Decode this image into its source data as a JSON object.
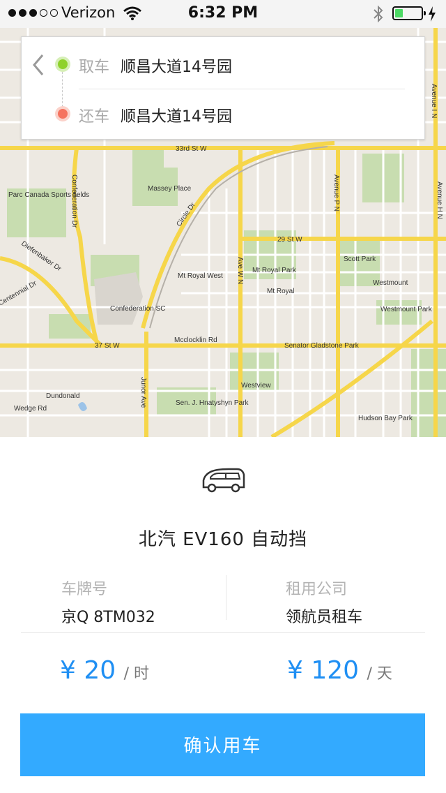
{
  "status_bar": {
    "carrier": "Verizon",
    "time": "6:32 PM",
    "signal_bars_filled": 3,
    "signal_bars_total": 5,
    "battery_level": 0.3
  },
  "route": {
    "pickup_label": "取车",
    "pickup_location": "顺昌大道14号园",
    "return_label": "还车",
    "return_location": "顺昌大道14号园"
  },
  "map": {
    "labels": [
      "33rd St W",
      "Parc Canada Sports fields",
      "Massey Place",
      "Confederation Dr",
      "Circle Dr",
      "29 St W",
      "Ave W N",
      "Avenue P N",
      "Avenue I N",
      "Avenue H N",
      "Scott Park",
      "Westmount",
      "Westmount Park",
      "Mt Royal Park",
      "Mt Royal",
      "Mt Royal West",
      "Confederation SC",
      "Diefenbaker Dr",
      "Centennial Dr",
      "Mcclocklin Rd",
      "37 St W",
      "Senator Gladstone Park",
      "Westview",
      "Dundonald",
      "Wedge Rd",
      "Junor Ave",
      "Sen. J. Hnatyshyn Park",
      "Hudson Bay Park"
    ]
  },
  "car": {
    "name": "北汽 EV160 自动挡",
    "plate_label": "车牌号",
    "plate_value": "京Q 8TM032",
    "company_label": "租用公司",
    "company_value": "领航员租车"
  },
  "pricing": {
    "hourly_currency": "¥",
    "hourly_amount": "20",
    "hourly_unit": "/ 时",
    "daily_currency": "¥",
    "daily_amount": "120",
    "daily_unit": "/ 天"
  },
  "confirm_button": "确认用车",
  "colors": {
    "accent": "#33aaff",
    "price": "#1f8ff3",
    "pickup_dot": "#8ed12a",
    "return_dot": "#f5735f",
    "road_major": "#f6d64a",
    "park": "#c8ddb0"
  }
}
